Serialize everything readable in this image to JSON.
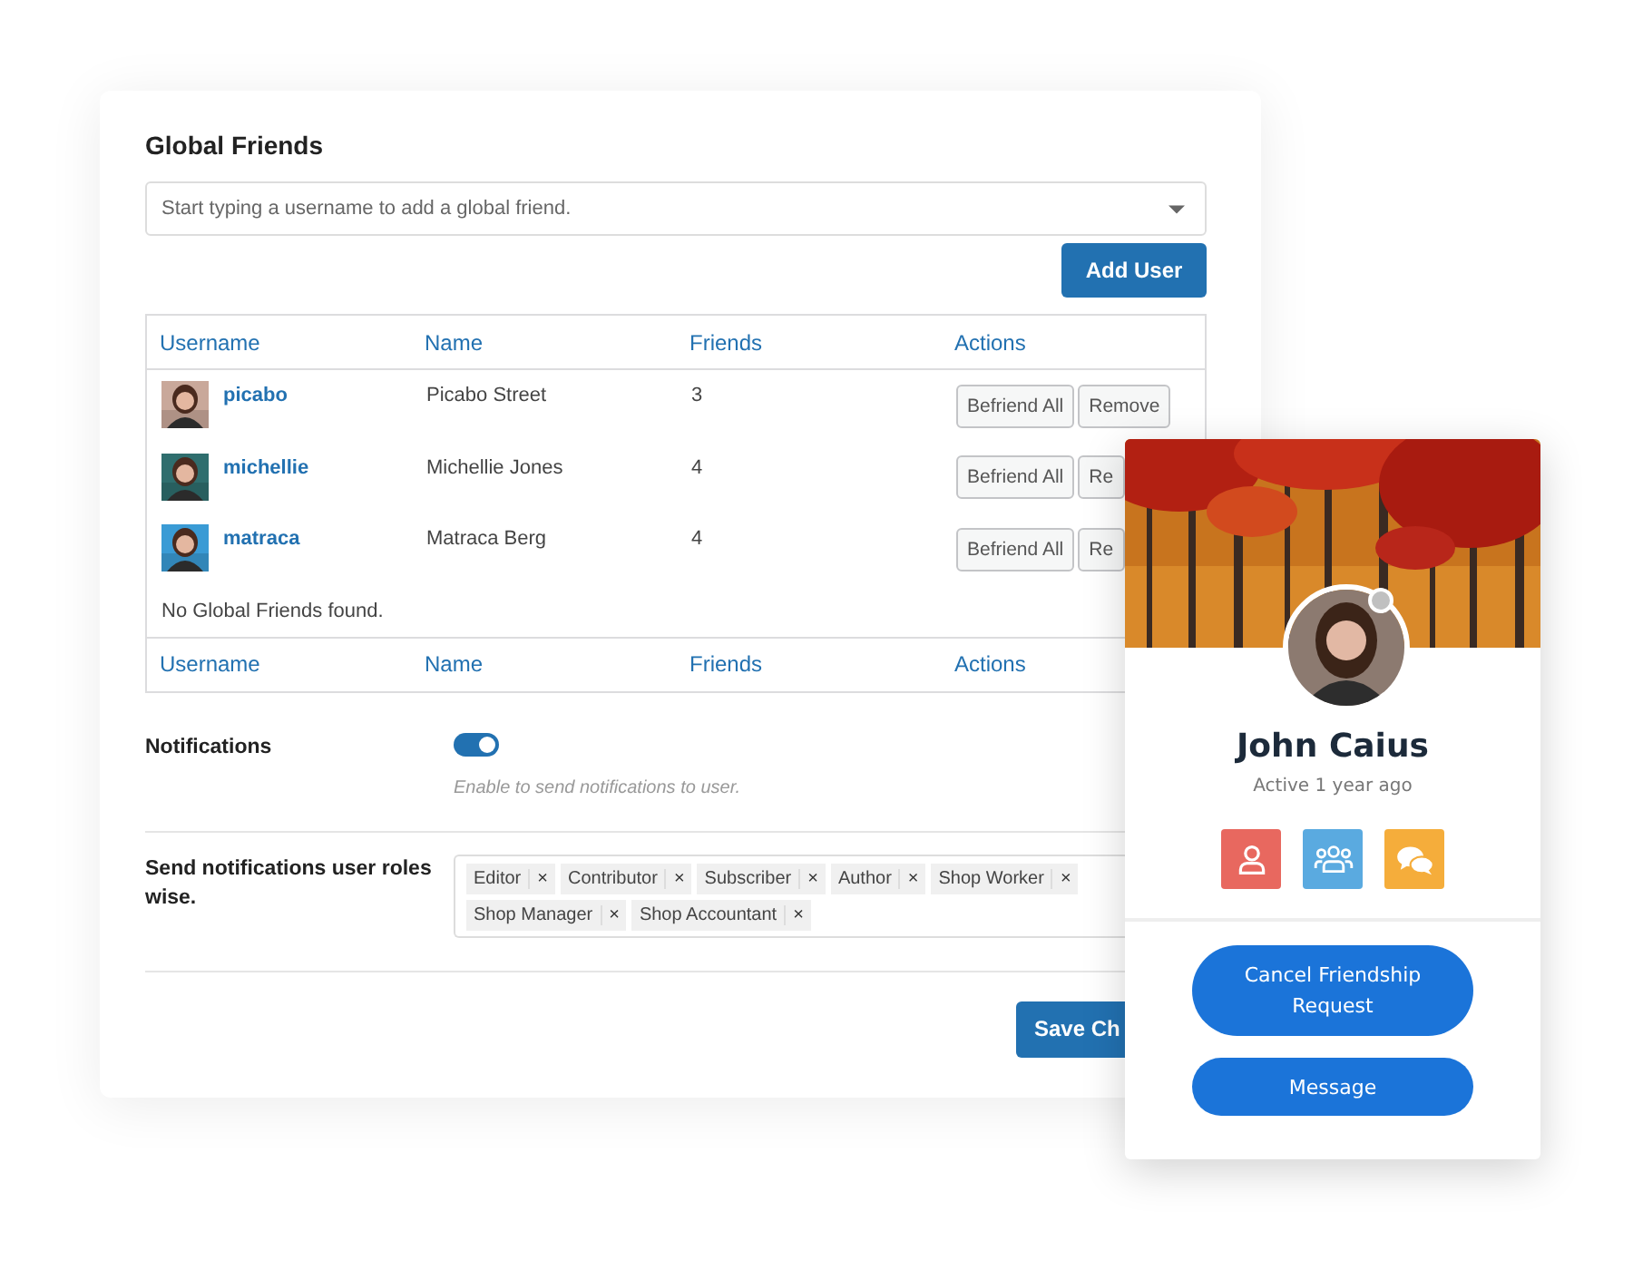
{
  "global_friends": {
    "title": "Global Friends",
    "search": {
      "placeholder": "Start typing a username to add a global friend."
    },
    "add_button": "Add User",
    "table": {
      "columns": [
        "Username",
        "Name",
        "Friends",
        "Actions"
      ],
      "rows": [
        {
          "username": "picabo",
          "name": "Picabo Street",
          "friends": "3",
          "actions": [
            "Befriend All",
            "Remove"
          ]
        },
        {
          "username": "michellie",
          "name": "Michellie Jones",
          "friends": "4",
          "actions": [
            "Befriend All",
            "Re"
          ]
        },
        {
          "username": "matraca",
          "name": "Matraca Berg",
          "friends": "4",
          "actions": [
            "Befriend All",
            "Re"
          ]
        }
      ],
      "empty_message": "No Global Friends found.",
      "footer_columns": [
        "Username",
        "Name",
        "Friends",
        "Actions"
      ]
    }
  },
  "notifications": {
    "label": "Notifications",
    "on": true,
    "hint": "Enable to send notifications to user."
  },
  "roles": {
    "label": "Send notifications user roles wise.",
    "tags": [
      {
        "label": "Editor",
        "remove": "×"
      },
      {
        "label": "Contributor",
        "remove": "×"
      },
      {
        "label": "Subscriber",
        "remove": "×"
      },
      {
        "label": "Author",
        "remove": "×"
      },
      {
        "label": "Shop Worker",
        "remove": "×"
      },
      {
        "label": "Shop Manager",
        "remove": "×"
      },
      {
        "label": "Shop Accountant",
        "remove": "×"
      }
    ]
  },
  "save_button": "Save Ch",
  "profile_card": {
    "name": "John Caius",
    "online": false,
    "activity": "Active 1 year ago",
    "actions": [
      {
        "kind": "profile",
        "color": "#e8685f"
      },
      {
        "kind": "friends",
        "color": "#5aaae0"
      },
      {
        "kind": "messages",
        "color": "#f5ad3b"
      }
    ],
    "buttons": [
      "Cancel Friendship Request",
      "Message"
    ]
  }
}
